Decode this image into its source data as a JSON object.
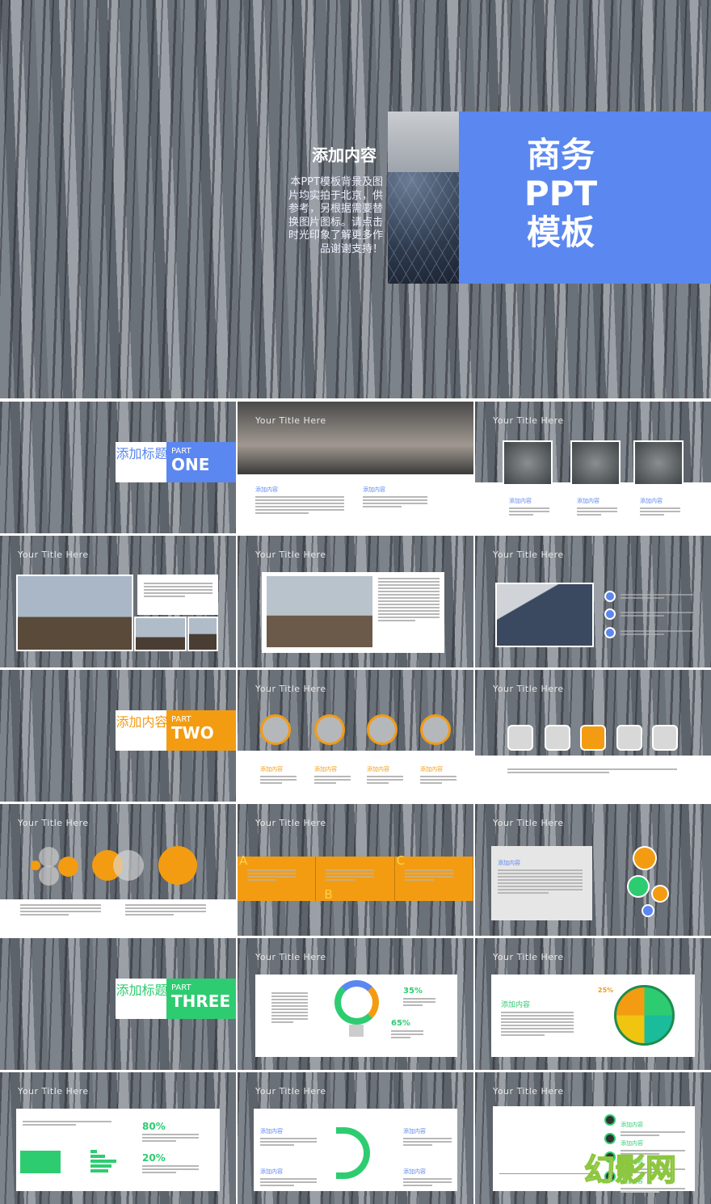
{
  "hero": {
    "title_lines": [
      "商务",
      "PPT",
      "模板"
    ],
    "heading": "添加内容",
    "body": "本PPT模板背景及图片均实拍于北京，供参考，另根据需要替换图片图标。请点击时光印象了解更多作品谢谢支持！"
  },
  "slide_title": "Your Title Here",
  "content_label": "添加内容",
  "sections": [
    {
      "title": "添加标题",
      "part": "PART",
      "num": "ONE",
      "color": "#5b87f0"
    },
    {
      "title": "添加内容",
      "part": "PART",
      "num": "TWO",
      "color": "#f39c12"
    },
    {
      "title": "添加标题",
      "part": "PART",
      "num": "THREE",
      "color": "#2ecc71"
    }
  ],
  "abc": [
    "A",
    "B",
    "C"
  ],
  "bulb": {
    "p1": "35%",
    "p2": "65%"
  },
  "pie": {
    "label": "25%"
  },
  "bars": {
    "p1": "80%",
    "p2": "20%",
    "values": [
      20,
      45,
      80,
      65,
      55
    ]
  },
  "watermark": "幻影网",
  "colors": {
    "blue": "#5b87f0",
    "orange": "#f39c12",
    "green": "#2ecc71"
  }
}
